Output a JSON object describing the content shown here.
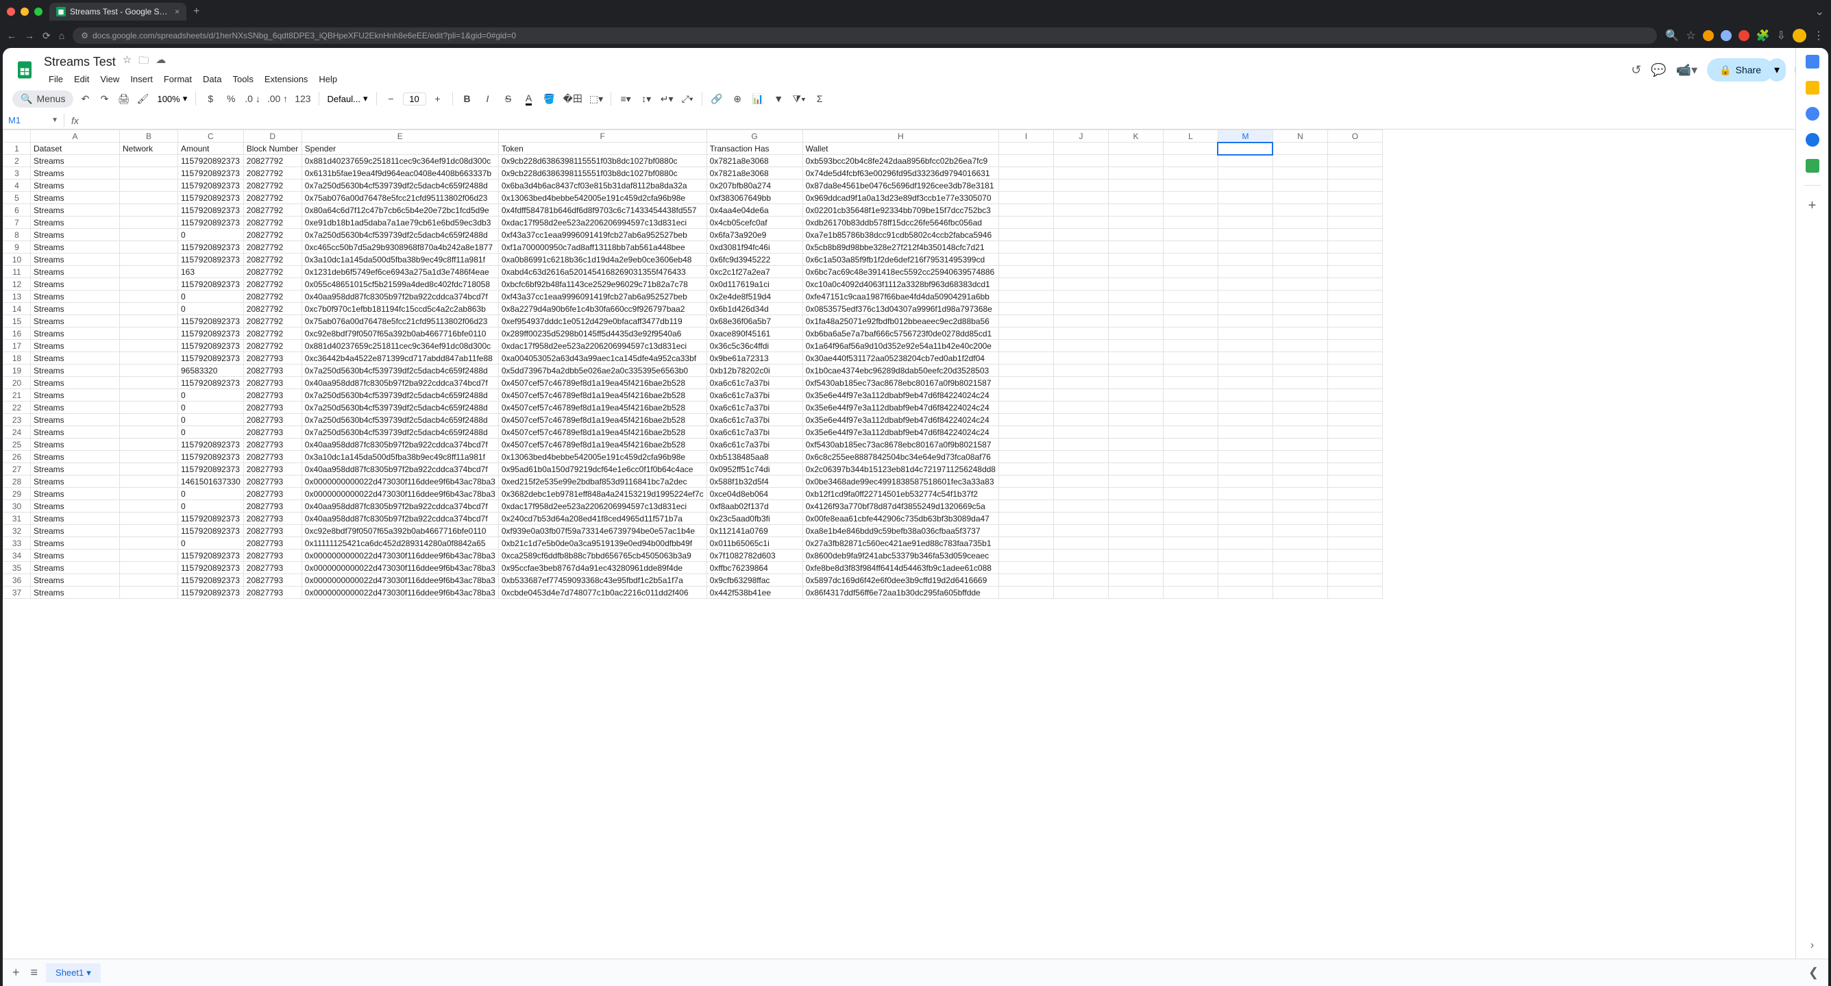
{
  "browser": {
    "tab_title": "Streams Test - Google Sheets",
    "url": "docs.google.com/spreadsheets/d/1herNXsSNbg_6qdt8DPE3_iQBHpeXFU2EknHnh8e6eEE/edit?pli=1&gid=0#gid=0"
  },
  "doc": {
    "title": "Streams Test",
    "menus": [
      "File",
      "Edit",
      "View",
      "Insert",
      "Format",
      "Data",
      "Tools",
      "Extensions",
      "Help"
    ],
    "share_label": "Share"
  },
  "toolbar": {
    "menus_label": "Menus",
    "zoom": "100%",
    "font": "Defaul...",
    "font_size": "10",
    "currency": "$",
    "percent": "%",
    "dec_dec": ".0",
    "inc_dec": ".00",
    "num_fmt": "123"
  },
  "namebox": {
    "ref": "M1"
  },
  "columns": [
    "A",
    "B",
    "C",
    "D",
    "E",
    "F",
    "G",
    "H",
    "I",
    "J",
    "K",
    "L",
    "M",
    "N",
    "O"
  ],
  "headers": [
    "Dataset",
    "Network",
    "Amount",
    "Block Number",
    "Spender",
    "Token",
    "Transaction Hash",
    "Wallet"
  ],
  "rows": [
    {
      "a": "Streams",
      "b": "",
      "c": "1157920892373",
      "d": "20827792",
      "e": "0x881d40237659c251811cec9c364ef91dc08d300c",
      "f": "0x9cb228d6386398115551f03b8dc1027bf0880c",
      "g": "0x7821a8e3068",
      "h": "0xb593bcc20b4c8fe242daa8956bfcc02b26ea7fc9"
    },
    {
      "a": "Streams",
      "b": "",
      "c": "1157920892373",
      "d": "20827792",
      "e": "0x6131b5fae19ea4f9d964eac0408e4408b663337b",
      "f": "0x9cb228d6386398115551f03b8dc1027bf0880c",
      "g": "0x7821a8e3068",
      "h": "0x74de5d4fcbf63e00296fd95d33236d9794016631"
    },
    {
      "a": "Streams",
      "b": "",
      "c": "1157920892373",
      "d": "20827792",
      "e": "0x7a250d5630b4cf539739df2c5dacb4c659f2488d",
      "f": "0x6ba3d4b6ac8437cf03e815b31daf8112ba8da32a",
      "g": "0x207bfb80a274",
      "h": "0x87da8e4561be0476c5696df1926cee3db78e3181"
    },
    {
      "a": "Streams",
      "b": "",
      "c": "1157920892373",
      "d": "20827792",
      "e": "0x75ab076a00d76478e5fcc21cfd95113802f06d23",
      "f": "0x13063bed4bebbe542005e191c459d2cfa96b98e",
      "g": "0xf383067649bb",
      "h": "0x969ddcad9f1a0a13d23e89df3ccb1e77e3305070"
    },
    {
      "a": "Streams",
      "b": "",
      "c": "1157920892373",
      "d": "20827792",
      "e": "0x80a64c6d7f12c47b7cb6c5b4e20e72bc1fcd5d9e",
      "f": "0x4fdff584781b646df6d8f9703c6c71433454438fd557",
      "g": "0x4aa4e04de6a",
      "h": "0x02201cb35648f1e92334bb709be15f7dcc752bc3"
    },
    {
      "a": "Streams",
      "b": "",
      "c": "1157920892373",
      "d": "20827792",
      "e": "0xe91db18b1ad5daba7a1ae79cb61e6bd59ec3db3",
      "f": "0xdac17f958d2ee523a2206206994597c13d831eci",
      "g": "0x4cb05cefc0af",
      "h": "0xdb26170b83ddb578ff15dcc26fe5646fbc056ad"
    },
    {
      "a": "Streams",
      "b": "",
      "c": "0",
      "d": "20827792",
      "e": "0x7a250d5630b4cf539739df2c5dacb4c659f2488d",
      "f": "0xf43a37cc1eaa9996091419fcb27ab6a952527beb",
      "g": "0x6fa73a920e9",
      "h": "0xa7e1b85786b38dcc91cdb5802c4ccb2fabca5946"
    },
    {
      "a": "Streams",
      "b": "",
      "c": "1157920892373",
      "d": "20827792",
      "e": "0xc465cc50b7d5a29b9308968f870a4b242a8e1877",
      "f": "0xf1a700000950c7ad8aff13118bb7ab561a448bee",
      "g": "0xd3081f94fc46i",
      "h": "0x5cb8b89d98bbe328e27f212f4b350148cfc7d21"
    },
    {
      "a": "Streams",
      "b": "",
      "c": "1157920892373",
      "d": "20827792",
      "e": "0x3a10dc1a145da500d5fba38b9ec49c8ff11a981f",
      "f": "0xa0b86991c6218b36c1d19d4a2e9eb0ce3606eb48",
      "g": "0x6fc9d3945222",
      "h": "0x6c1a503a85f9fb1f2de6def216f79531495399cd"
    },
    {
      "a": "Streams",
      "b": "",
      "c": "163",
      "d": "20827792",
      "e": "0x1231deb6f5749ef6ce6943a275a1d3e7486f4eae",
      "f": "0xabd4c63d2616a5201454168269031355f476433",
      "g": "0xc2c1f27a2ea7",
      "h": "0x6bc7ac69c48e391418ec5592cc25940639574886"
    },
    {
      "a": "Streams",
      "b": "",
      "c": "1157920892373",
      "d": "20827792",
      "e": "0x055c48651015cf5b21599a4ded8c402fdc718058",
      "f": "0xbcfc6bf92b48fa1143ce2529e96029c71b82a7c78",
      "g": "0x0d117619a1ci",
      "h": "0xc10a0c4092d4063f1112a3328bf963d68383dcd1"
    },
    {
      "a": "Streams",
      "b": "",
      "c": "0",
      "d": "20827792",
      "e": "0x40aa958dd87fc8305b97f2ba922cddca374bcd7f",
      "f": "0xf43a37cc1eaa9996091419fcb27ab6a952527beb",
      "g": "0x2e4de8f519d4",
      "h": "0xfe47151c9caa1987f66bae4fd4da50904291a6bb"
    },
    {
      "a": "Streams",
      "b": "",
      "c": "0",
      "d": "20827792",
      "e": "0xc7b0f970c1efbb181194fc15ccd5c4a2c2ab863b",
      "f": "0x8a2279d4a90b6fe1c4b30fa660cc9f926797baa2",
      "g": "0x6b1d426d34d",
      "h": "0x0853575edf376c13d04307a9996f1d98a797368e"
    },
    {
      "a": "Streams",
      "b": "",
      "c": "1157920892373",
      "d": "20827792",
      "e": "0x75ab076a00d76478e5fcc21cfd95113802f06d23",
      "f": "0xef954937dddc1e0512d429e0bfacaff3477db119",
      "g": "0x68e36f06a5b7",
      "h": "0x1fa48a25071e92fbdfb012bbeaeec9ec2d88ba56"
    },
    {
      "a": "Streams",
      "b": "",
      "c": "1157920892373",
      "d": "20827792",
      "e": "0xc92e8bdf79f0507f65a392b0ab4667716bfe0110",
      "f": "0x289ff00235d5298b0145ff5d4435d3e92f9540a6",
      "g": "0xace890f45161",
      "h": "0xb6ba6a5e7a7baf666c5756723f0de0278dd85cd1"
    },
    {
      "a": "Streams",
      "b": "",
      "c": "1157920892373",
      "d": "20827792",
      "e": "0x881d40237659c251811cec9c364ef91dc08d300c",
      "f": "0xdac17f958d2ee523a2206206994597c13d831eci",
      "g": "0x36c5c36c4ffdi",
      "h": "0x1a64f96af56a9d10d352e92e54a11b42e40c200e"
    },
    {
      "a": "Streams",
      "b": "",
      "c": "1157920892373",
      "d": "20827793",
      "e": "0xc36442b4a4522e871399cd717abdd847ab11fe88",
      "f": "0xa004053052a63d43a99aec1ca145dfe4a952ca33bf",
      "g": "0x9be61a72313",
      "h": "0x30ae440f531172aa05238204cb7ed0ab1f2df04"
    },
    {
      "a": "Streams",
      "b": "",
      "c": "96583320",
      "d": "20827793",
      "e": "0x7a250d5630b4cf539739df2c5dacb4c659f2488d",
      "f": "0x5dd73967b4a2dbb5e026ae2a0c335395e6563b0",
      "g": "0xb12b78202c0i",
      "h": "0x1b0cae4374ebc96289d8dab50eefc20d3528503"
    },
    {
      "a": "Streams",
      "b": "",
      "c": "1157920892373",
      "d": "20827793",
      "e": "0x40aa958dd87fc8305b97f2ba922cddca374bcd7f",
      "f": "0x4507cef57c46789ef8d1a19ea45f4216bae2b528",
      "g": "0xa6c61c7a37bi",
      "h": "0xf5430ab185ec73ac8678ebc80167a0f9b8021587"
    },
    {
      "a": "Streams",
      "b": "",
      "c": "0",
      "d": "20827793",
      "e": "0x7a250d5630b4cf539739df2c5dacb4c659f2488d",
      "f": "0x4507cef57c46789ef8d1a19ea45f4216bae2b528",
      "g": "0xa6c61c7a37bi",
      "h": "0x35e6e44f97e3a112dbabf9eb47d6f84224024c24"
    },
    {
      "a": "Streams",
      "b": "",
      "c": "0",
      "d": "20827793",
      "e": "0x7a250d5630b4cf539739df2c5dacb4c659f2488d",
      "f": "0x4507cef57c46789ef8d1a19ea45f4216bae2b528",
      "g": "0xa6c61c7a37bi",
      "h": "0x35e6e44f97e3a112dbabf9eb47d6f84224024c24"
    },
    {
      "a": "Streams",
      "b": "",
      "c": "0",
      "d": "20827793",
      "e": "0x7a250d5630b4cf539739df2c5dacb4c659f2488d",
      "f": "0x4507cef57c46789ef8d1a19ea45f4216bae2b528",
      "g": "0xa6c61c7a37bi",
      "h": "0x35e6e44f97e3a112dbabf9eb47d6f84224024c24"
    },
    {
      "a": "Streams",
      "b": "",
      "c": "0",
      "d": "20827793",
      "e": "0x7a250d5630b4cf539739df2c5dacb4c659f2488d",
      "f": "0x4507cef57c46789ef8d1a19ea45f4216bae2b528",
      "g": "0xa6c61c7a37bi",
      "h": "0x35e6e44f97e3a112dbabf9eb47d6f84224024c24"
    },
    {
      "a": "Streams",
      "b": "",
      "c": "1157920892373",
      "d": "20827793",
      "e": "0x40aa958dd87fc8305b97f2ba922cddca374bcd7f",
      "f": "0x4507cef57c46789ef8d1a19ea45f4216bae2b528",
      "g": "0xa6c61c7a37bi",
      "h": "0xf5430ab185ec73ac8678ebc80167a0f9b8021587"
    },
    {
      "a": "Streams",
      "b": "",
      "c": "1157920892373",
      "d": "20827793",
      "e": "0x3a10dc1a145da500d5fba38b9ec49c8ff11a981f",
      "f": "0x13063bed4bebbe542005e191c459d2cfa96b98e",
      "g": "0xb5138485aa8",
      "h": "0x6c8c255ee8887842504bc34e64e9d73fca08af76"
    },
    {
      "a": "Streams",
      "b": "",
      "c": "1157920892373",
      "d": "20827793",
      "e": "0x40aa958dd87fc8305b97f2ba922cddca374bcd7f",
      "f": "0x95ad61b0a150d79219dcf64e1e6cc0f1f0b64c4ace",
      "g": "0x0952ff51c74di",
      "h": "0x2c06397b344b15123eb81d4c7219711256248dd8"
    },
    {
      "a": "Streams",
      "b": "",
      "c": "1461501637330",
      "d": "20827793",
      "e": "0x0000000000022d473030f116ddee9f6b43ac78ba3",
      "f": "0xed215f2e535e99e2bdbaf853d9116841bc7a2dec",
      "g": "0x588f1b32d5f4",
      "h": "0x0be3468ade99ec4991838587518601fec3a33a83"
    },
    {
      "a": "Streams",
      "b": "",
      "c": "0",
      "d": "20827793",
      "e": "0x0000000000022d473030f116ddee9f6b43ac78ba3",
      "f": "0x3682debc1eb9781eff848a4a24153219d1995224ef7c",
      "g": "0xce04d8eb064",
      "h": "0xb12f1cd9fa0ff22714501eb532774c54f1b37f2"
    },
    {
      "a": "Streams",
      "b": "",
      "c": "0",
      "d": "20827793",
      "e": "0x40aa958dd87fc8305b97f2ba922cddca374bcd7f",
      "f": "0xdac17f958d2ee523a2206206994597c13d831eci",
      "g": "0xf8aab02f137d",
      "h": "0x4126f93a770bf78d87d4f3855249d1320669c5a"
    },
    {
      "a": "Streams",
      "b": "",
      "c": "1157920892373",
      "d": "20827793",
      "e": "0x40aa958dd87fc8305b97f2ba922cddca374bcd7f",
      "f": "0x240cd7b53d64a208ed41f8ced4965d11f571b7a",
      "g": "0x23c5aad0fb3fi",
      "h": "0x00fe8eaa61cbfe442906c735db63bf3b3089da47"
    },
    {
      "a": "Streams",
      "b": "",
      "c": "1157920892373",
      "d": "20827793",
      "e": "0xc92e8bdf79f0507f65a392b0ab4667716bfe0110",
      "f": "0xf939e0a03fb07f59a73314e6739794be0e57ac1b4e",
      "g": "0x112141a0769",
      "h": "0xa8e1b4e846bdd9c59befb38a036cfbaa5f3737"
    },
    {
      "a": "Streams",
      "b": "",
      "c": "0",
      "d": "20827793",
      "e": "0x11111125421ca6dc452d289314280a0f8842a65",
      "f": "0xb21c1d7e5b0de0a3ca9519139e0ed94b00dfbb49f",
      "g": "0x011b65065c1i",
      "h": "0x27a3fb82871c560ec421ae91ed88c783faa735b1"
    },
    {
      "a": "Streams",
      "b": "",
      "c": "1157920892373",
      "d": "20827793",
      "e": "0x0000000000022d473030f116ddee9f6b43ac78ba3",
      "f": "0xca2589cf6ddfb8b88c7bbd656765cb4505063b3a9",
      "g": "0x7f1082782d603",
      "h": "0x8600deb9fa9f241abc53379b346fa53d059ceaec"
    },
    {
      "a": "Streams",
      "b": "",
      "c": "1157920892373",
      "d": "20827793",
      "e": "0x0000000000022d473030f116ddee9f6b43ac78ba3",
      "f": "0x95ccfae3beb8767d4a91ec43280961dde89f4de",
      "g": "0xffbc76239864",
      "h": "0xfe8be8d3f83f984ff6414d54463fb9c1adee61c088"
    },
    {
      "a": "Streams",
      "b": "",
      "c": "1157920892373",
      "d": "20827793",
      "e": "0x0000000000022d473030f116ddee9f6b43ac78ba3",
      "f": "0xb533687ef77459093368c43e95fbdf1c2b5a1f7a",
      "g": "0x9cfb63298ffac",
      "h": "0x5897dc169d6f42e6f0dee3b9cffd19d2d6416669"
    },
    {
      "a": "Streams",
      "b": "",
      "c": "1157920892373",
      "d": "20827793",
      "e": "0x0000000000022d473030f116ddee9f6b43ac78ba3",
      "f": "0xcbde0453d4e7d748077c1b0ac2216c011dd2f406",
      "g": "0x442f538b41ee",
      "h": "0x86f4317ddf56ff6e72aa1b30dc295fa605bffdde"
    }
  ],
  "sheet_tab": "Sheet1"
}
